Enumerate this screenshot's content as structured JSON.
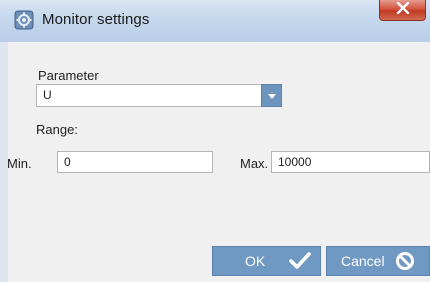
{
  "window": {
    "title": "Monitor settings",
    "title_icon": "gear-icon",
    "close_icon": "close-icon"
  },
  "form": {
    "parameter_label": "Parameter",
    "parameter_value": "U",
    "range_label": "Range:",
    "min_label": "Min.",
    "min_value": "0",
    "max_label": "Max.",
    "max_value": "10000"
  },
  "buttons": {
    "ok_label": "OK",
    "ok_icon": "checkmark-icon",
    "cancel_label": "Cancel",
    "cancel_icon": "prohibited-icon"
  },
  "colors": {
    "accent": "#6f98c2",
    "close": "#c8442c"
  }
}
